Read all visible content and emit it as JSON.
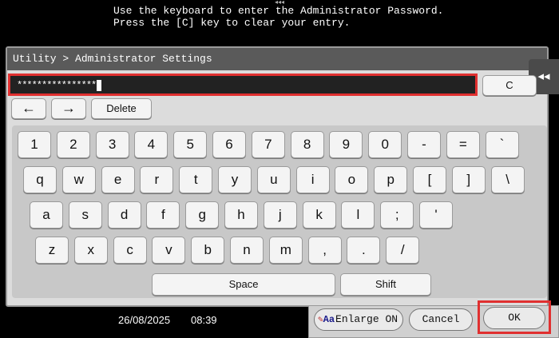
{
  "message": {
    "line1": "Use the keyboard to enter the Administrator Password.",
    "line2": "Press the [C] key to clear your entry."
  },
  "window": {
    "breadcrumb": "Utility > Administrator Settings"
  },
  "password": {
    "masked_value": "****************"
  },
  "controls": {
    "clear_label": "C",
    "left_arrow": "←",
    "right_arrow": "→",
    "delete_label": "Delete",
    "space_label": "Space",
    "shift_label": "Shift",
    "side_collapse": "◂◂"
  },
  "keyboard": {
    "rows": [
      [
        "1",
        "2",
        "3",
        "4",
        "5",
        "6",
        "7",
        "8",
        "9",
        "0",
        "-",
        "=",
        "`"
      ],
      [
        "q",
        "w",
        "e",
        "r",
        "t",
        "y",
        "u",
        "i",
        "o",
        "p",
        "[",
        "]",
        "\\"
      ],
      [
        "a",
        "s",
        "d",
        "f",
        "g",
        "h",
        "j",
        "k",
        "l",
        ";",
        "'"
      ],
      [
        "z",
        "x",
        "c",
        "v",
        "b",
        "n",
        "m",
        ",",
        ".",
        "/"
      ]
    ]
  },
  "footer": {
    "date": "26/08/2025",
    "time": "08:39",
    "enlarge_label": "Enlarge ON",
    "cancel_label": "Cancel",
    "ok_label": "OK"
  },
  "colors": {
    "highlight": "#e03030",
    "titlebar": "#5a5a5a",
    "keyboard_bg": "#c8c8c8"
  }
}
